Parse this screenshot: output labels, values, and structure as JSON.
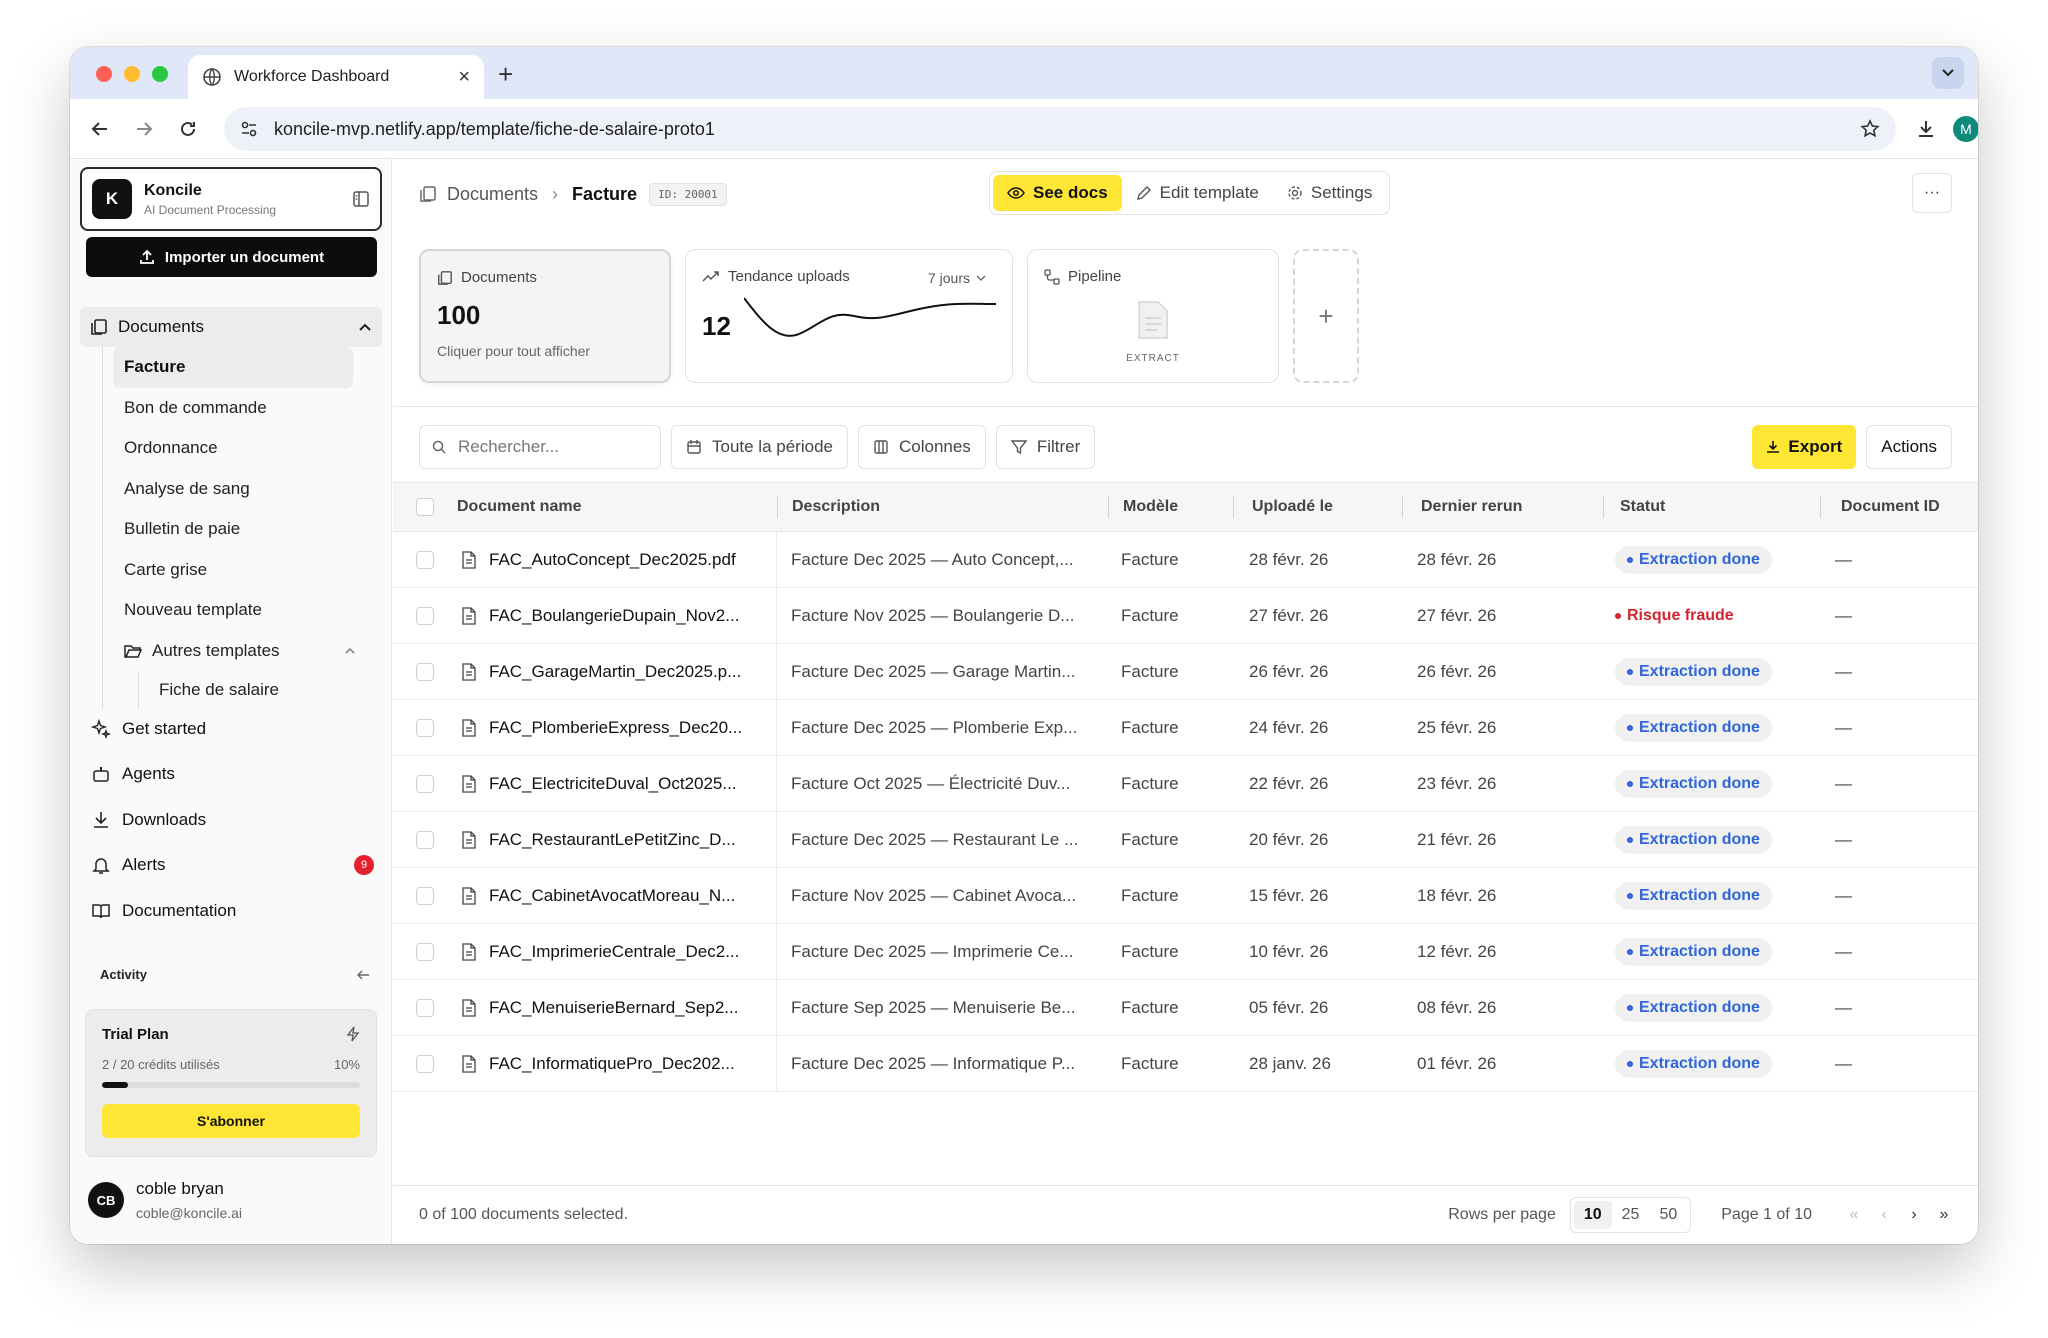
{
  "browser": {
    "tab_title": "Workforce Dashboard",
    "url": "koncile-mvp.netlify.app/template/fiche-de-salaire-proto1",
    "profile_initial": "M"
  },
  "brand": {
    "name": "Koncile",
    "subtitle": "AI Document Processing",
    "logo_letter": "K"
  },
  "sidebar": {
    "import_label": "Importer un document",
    "documents_label": "Documents",
    "doc_types": [
      "Facture",
      "Bon de commande",
      "Ordonnance",
      "Analyse de sang",
      "Bulletin de paie",
      "Carte grise",
      "Nouveau template"
    ],
    "other_templates_label": "Autres templates",
    "other_templates": [
      "Fiche de salaire"
    ],
    "nav": [
      {
        "label": "Get started",
        "icon": "sparkles-icon"
      },
      {
        "label": "Agents",
        "icon": "bot-icon"
      },
      {
        "label": "Downloads",
        "icon": "download-icon"
      },
      {
        "label": "Alerts",
        "icon": "bell-icon",
        "badge": "9"
      },
      {
        "label": "Documentation",
        "icon": "book-icon"
      }
    ],
    "activity_label": "Activity",
    "trial": {
      "title": "Trial Plan",
      "credits": "2 / 20 crédits utilisés",
      "percent_label": "10%",
      "progress": 0.1,
      "cta": "S'abonner"
    },
    "user": {
      "initials": "CB",
      "name": "coble bryan",
      "email": "coble@koncile.ai"
    }
  },
  "header": {
    "crumb_root": "Documents",
    "crumb_current": "Facture",
    "id_tag": "ID: 20001",
    "see_docs": "See docs",
    "edit_template": "Edit template",
    "settings": "Settings",
    "more": "···"
  },
  "cards": {
    "documents": {
      "title": "Documents",
      "value": "100",
      "sub": "Cliquer pour tout afficher"
    },
    "trend": {
      "title": "Tendance uploads",
      "period": "7 jours",
      "value": "12"
    },
    "pipeline": {
      "title": "Pipeline",
      "step": "EXTRACT"
    },
    "add": "+"
  },
  "toolbar": {
    "search_placeholder": "Rechercher...",
    "period": "Toute la période",
    "columns": "Colonnes",
    "filter": "Filtrer",
    "export": "Export",
    "actions": "Actions"
  },
  "table": {
    "headers": {
      "name": "Document name",
      "description": "Description",
      "model": "Modèle",
      "uploaded": "Uploadé le",
      "rerun": "Dernier rerun",
      "status": "Statut",
      "doc_id": "Document ID"
    },
    "rows": [
      {
        "name": "FAC_AutoConcept_Dec2025.pdf",
        "desc": "Facture Dec 2025 — Auto Concept,...",
        "model": "Facture",
        "up": "28 févr. 26",
        "rr": "28 févr. 26",
        "status": "Extraction done",
        "id": "—"
      },
      {
        "name": "FAC_BoulangerieDupain_Nov2...",
        "desc": "Facture Nov 2025 — Boulangerie D...",
        "model": "Facture",
        "up": "27 févr. 26",
        "rr": "27 févr. 26",
        "status": "Risque fraude",
        "id": "—"
      },
      {
        "name": "FAC_GarageMartin_Dec2025.p...",
        "desc": "Facture Dec 2025 — Garage Martin...",
        "model": "Facture",
        "up": "26 févr. 26",
        "rr": "26 févr. 26",
        "status": "Extraction done",
        "id": "—"
      },
      {
        "name": "FAC_PlomberieExpress_Dec20...",
        "desc": "Facture Dec 2025 — Plomberie Exp...",
        "model": "Facture",
        "up": "24 févr. 26",
        "rr": "25 févr. 26",
        "status": "Extraction done",
        "id": "—"
      },
      {
        "name": "FAC_ElectriciteDuval_Oct2025...",
        "desc": "Facture Oct 2025 — Électricité Duv...",
        "model": "Facture",
        "up": "22 févr. 26",
        "rr": "23 févr. 26",
        "status": "Extraction done",
        "id": "—"
      },
      {
        "name": "FAC_RestaurantLePetitZinc_D...",
        "desc": "Facture Dec 2025 — Restaurant Le ...",
        "model": "Facture",
        "up": "20 févr. 26",
        "rr": "21 févr. 26",
        "status": "Extraction done",
        "id": "—"
      },
      {
        "name": "FAC_CabinetAvocatMoreau_N...",
        "desc": "Facture Nov 2025 — Cabinet Avoca...",
        "model": "Facture",
        "up": "15 févr. 26",
        "rr": "18 févr. 26",
        "status": "Extraction done",
        "id": "—"
      },
      {
        "name": "FAC_ImprimerieCentrale_Dec2...",
        "desc": "Facture Dec 2025 — Imprimerie Ce...",
        "model": "Facture",
        "up": "10 févr. 26",
        "rr": "12 févr. 26",
        "status": "Extraction done",
        "id": "—"
      },
      {
        "name": "FAC_MenuiserieBernard_Sep2...",
        "desc": "Facture Sep 2025 — Menuiserie Be...",
        "model": "Facture",
        "up": "05 févr. 26",
        "rr": "08 févr. 26",
        "status": "Extraction done",
        "id": "—"
      },
      {
        "name": "FAC_InformatiquePro_Dec202...",
        "desc": "Facture Dec 2025 — Informatique P...",
        "model": "Facture",
        "up": "28 janv. 26",
        "rr": "01 févr. 26",
        "status": "Extraction done",
        "id": "—"
      }
    ]
  },
  "footer": {
    "selected": "0 of 100 documents selected.",
    "rows_per_page_label": "Rows per page",
    "rows_options": [
      "10",
      "25",
      "50"
    ],
    "rows_selected": "10",
    "page_info": "Page 1 of 10"
  },
  "colors": {
    "accent_yellow": "#ffe534",
    "status_blue": "#2f66d9",
    "status_red": "#d3252f"
  }
}
